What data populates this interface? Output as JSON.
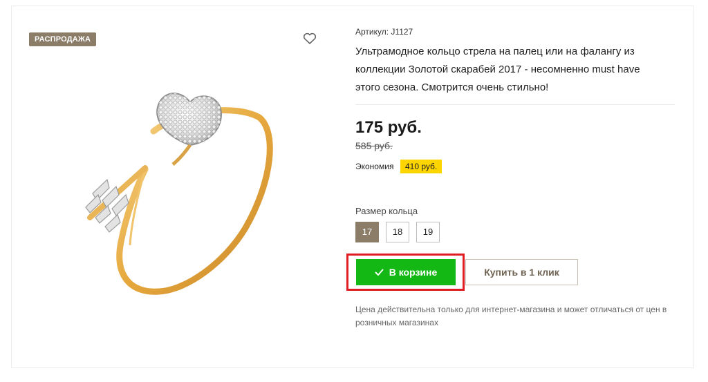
{
  "product": {
    "badge": "РАСПРОДАЖА",
    "sku": "Артикул: J1127",
    "description": "Ультрамодное кольцо стрела на палец или на фалангу из коллекции Золотой скарабей 2017 - несомненно must have этого сезона. Смотрится очень стильно!",
    "price_current": "175 руб.",
    "price_old": "585 руб.",
    "savings_label": "Экономия",
    "savings_value": "410 руб.",
    "size_label": "Размер кольца",
    "sizes": [
      "17",
      "18",
      "19"
    ],
    "selected_size": "17",
    "cart_button": "В корзине",
    "buy_one_click": "Купить в 1 клик",
    "note": "Цена действительна только для интернет-магазина и может отличаться от цен в розничных магазинах"
  },
  "colors": {
    "badge": "#8b7d68",
    "cart_button": "#14b814",
    "savings_badge": "#ffd500",
    "highlight": "#e11b22"
  },
  "icons": {
    "favorite": "heart-icon",
    "cart_check": "checkmark-icon"
  }
}
